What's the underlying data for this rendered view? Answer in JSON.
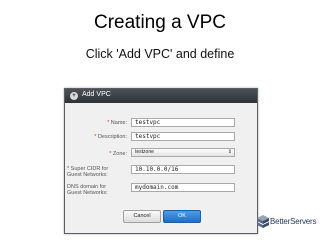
{
  "slide": {
    "title": "Creating a VPC",
    "subtitle": "Click 'Add VPC' and define"
  },
  "dialog": {
    "title": "Add VPC",
    "fields": {
      "name": {
        "required_mark": "*",
        "label": "Name:",
        "value": "testvpc"
      },
      "description": {
        "required_mark": "*",
        "label": "Description:",
        "value": "testvpc"
      },
      "zone": {
        "required_mark": "*",
        "label": "Zone:",
        "value": "testzone"
      },
      "super_cidr": {
        "required_mark": "*",
        "label_line1": "Super CIDR for",
        "label_line2": "Guest Networks:",
        "value": "10.10.0.0/16"
      },
      "dns_domain": {
        "label_line1": "DNS domain for",
        "label_line2": "Guest Networks:",
        "value": "mydomain.com"
      }
    },
    "buttons": {
      "cancel_label": "Cancel",
      "ok_label": "OK"
    }
  },
  "branding": {
    "logo_text": "BetterServers"
  },
  "colors": {
    "header": "#2e3236",
    "ok_button": "#1f6fc9",
    "logo_text": "#2a3a5c"
  }
}
